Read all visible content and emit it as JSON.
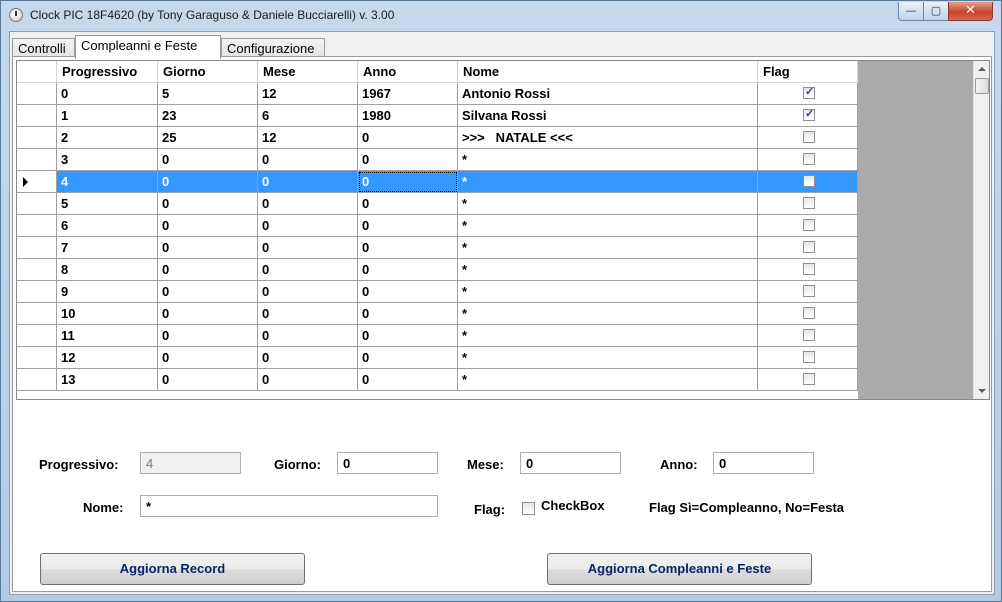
{
  "window": {
    "title": "Clock PIC 18F4620 (by Tony Garaguso & Daniele Bucciarelli) v. 3.00",
    "minimize": "—",
    "maximize": "▢",
    "close": "✕"
  },
  "tabs": [
    {
      "label": "Controlli"
    },
    {
      "label": "Compleanni e Feste"
    },
    {
      "label": "Configurazione"
    }
  ],
  "grid": {
    "columns": [
      "Progressivo",
      "Giorno",
      "Mese",
      "Anno",
      "Nome",
      "Flag"
    ],
    "rows": [
      {
        "progressivo": "0",
        "giorno": "5",
        "mese": "12",
        "anno": "1967",
        "nome": "Antonio Rossi",
        "flag": true
      },
      {
        "progressivo": "1",
        "giorno": "23",
        "mese": "6",
        "anno": "1980",
        "nome": "Silvana Rossi",
        "flag": true
      },
      {
        "progressivo": "2",
        "giorno": "25",
        "mese": "12",
        "anno": "0",
        "nome": ">>>   NATALE <<<",
        "flag": false
      },
      {
        "progressivo": "3",
        "giorno": "0",
        "mese": "0",
        "anno": "0",
        "nome": "*",
        "flag": false
      },
      {
        "progressivo": "4",
        "giorno": "0",
        "mese": "0",
        "anno": "0",
        "nome": "*",
        "flag": false
      },
      {
        "progressivo": "5",
        "giorno": "0",
        "mese": "0",
        "anno": "0",
        "nome": "*",
        "flag": false
      },
      {
        "progressivo": "6",
        "giorno": "0",
        "mese": "0",
        "anno": "0",
        "nome": "*",
        "flag": false
      },
      {
        "progressivo": "7",
        "giorno": "0",
        "mese": "0",
        "anno": "0",
        "nome": "*",
        "flag": false
      },
      {
        "progressivo": "8",
        "giorno": "0",
        "mese": "0",
        "anno": "0",
        "nome": "*",
        "flag": false
      },
      {
        "progressivo": "9",
        "giorno": "0",
        "mese": "0",
        "anno": "0",
        "nome": "*",
        "flag": false
      },
      {
        "progressivo": "10",
        "giorno": "0",
        "mese": "0",
        "anno": "0",
        "nome": "*",
        "flag": false
      },
      {
        "progressivo": "11",
        "giorno": "0",
        "mese": "0",
        "anno": "0",
        "nome": "*",
        "flag": false
      },
      {
        "progressivo": "12",
        "giorno": "0",
        "mese": "0",
        "anno": "0",
        "nome": "*",
        "flag": false
      },
      {
        "progressivo": "13",
        "giorno": "0",
        "mese": "0",
        "anno": "0",
        "nome": "*",
        "flag": false
      }
    ]
  },
  "form": {
    "progressivo_label": "Progressivo:",
    "progressivo_value": "4",
    "giorno_label": "Giorno:",
    "giorno_value": "0",
    "mese_label": "Mese:",
    "mese_value": "0",
    "anno_label": "Anno:",
    "anno_value": "0",
    "nome_label": "Nome:",
    "nome_value": "*",
    "flag_label": "Flag:",
    "flag_checkbox_label": "CheckBox",
    "flag_hint": "Flag Sì=Compleanno, No=Festa"
  },
  "buttons": {
    "aggiorna_record": "Aggiorna Record",
    "aggiorna_compleanni": "Aggiorna Compleanni e Feste"
  }
}
